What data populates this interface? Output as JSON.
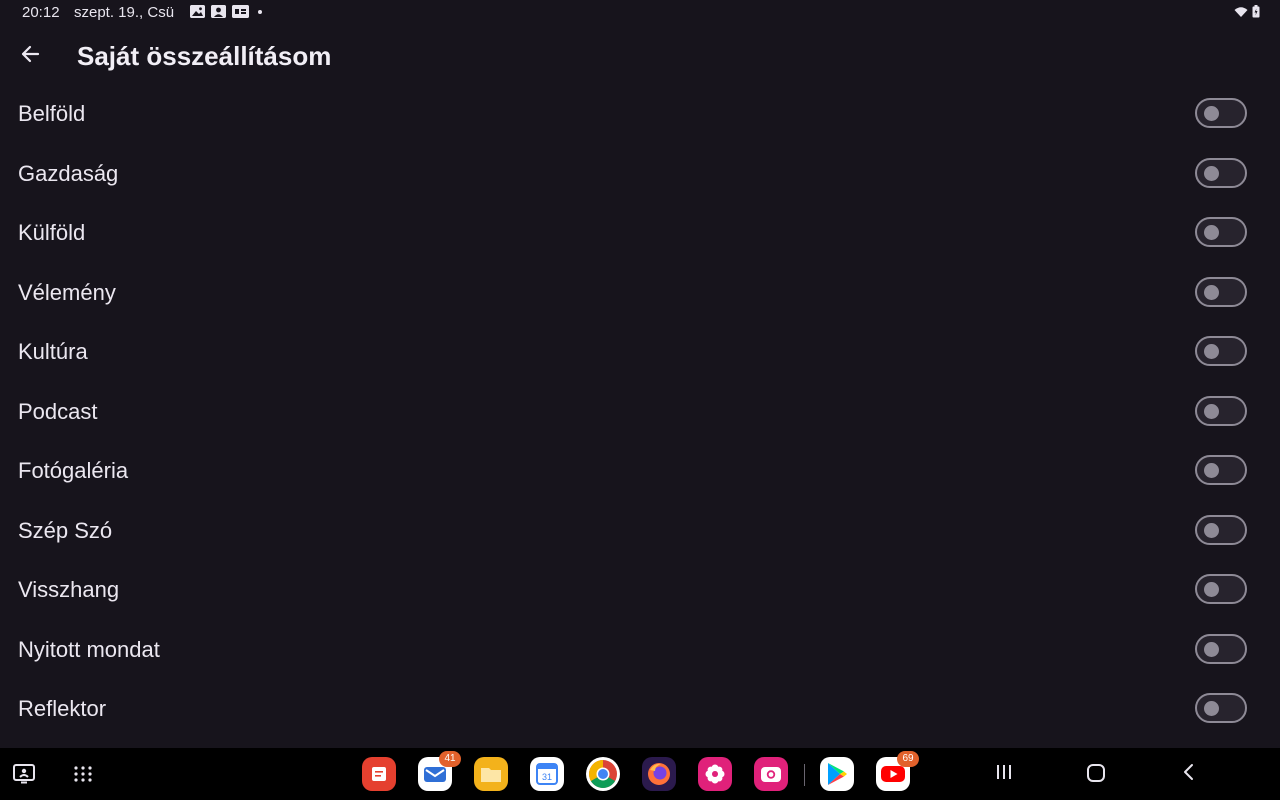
{
  "status_bar": {
    "time": "20:12",
    "date": "szept. 19., Csü",
    "notification_icons": [
      "gallery-icon",
      "contacts-icon",
      "chat-icon"
    ],
    "system_icons": [
      "wifi-icon",
      "battery-icon"
    ]
  },
  "header": {
    "title": "Saját összeállításom",
    "back_icon": "arrow-left-icon"
  },
  "categories": [
    {
      "label": "Belföld",
      "enabled": false
    },
    {
      "label": "Gazdaság",
      "enabled": false
    },
    {
      "label": "Külföld",
      "enabled": false
    },
    {
      "label": "Vélemény",
      "enabled": false
    },
    {
      "label": "Kultúra",
      "enabled": false
    },
    {
      "label": "Podcast",
      "enabled": false
    },
    {
      "label": "Fotógaléria",
      "enabled": false
    },
    {
      "label": "Szép Szó",
      "enabled": false
    },
    {
      "label": "Visszhang",
      "enabled": false
    },
    {
      "label": "Nyitott mondat",
      "enabled": false
    },
    {
      "label": "Reflektor",
      "enabled": false
    }
  ],
  "taskbar": {
    "left_icons": [
      "recent-screen-icon",
      "app-drawer-icon"
    ],
    "apps": [
      {
        "name": "notes-app-icon",
        "color": "#e5402f"
      },
      {
        "name": "mail-app-icon",
        "color": "#2f6fd6",
        "badge": "41"
      },
      {
        "name": "files-app-icon",
        "color": "#f3b21b"
      },
      {
        "name": "calendar-app-icon",
        "color": "#3d84f5",
        "text": "31"
      },
      {
        "name": "chrome-app-icon",
        "color": "#ffffff"
      },
      {
        "name": "firefox-app-icon",
        "color": "#2b1a4d"
      },
      {
        "name": "flower-app-icon",
        "color": "#e0217a"
      },
      {
        "name": "camera-app-icon",
        "color": "#e0217a"
      },
      {
        "name": "play-store-app-icon",
        "color": "#ffffff"
      },
      {
        "name": "youtube-app-icon",
        "color": "#ffffff",
        "badge": "69"
      }
    ],
    "system_nav": [
      "recents-button-icon",
      "home-button-icon",
      "back-button-icon"
    ]
  }
}
